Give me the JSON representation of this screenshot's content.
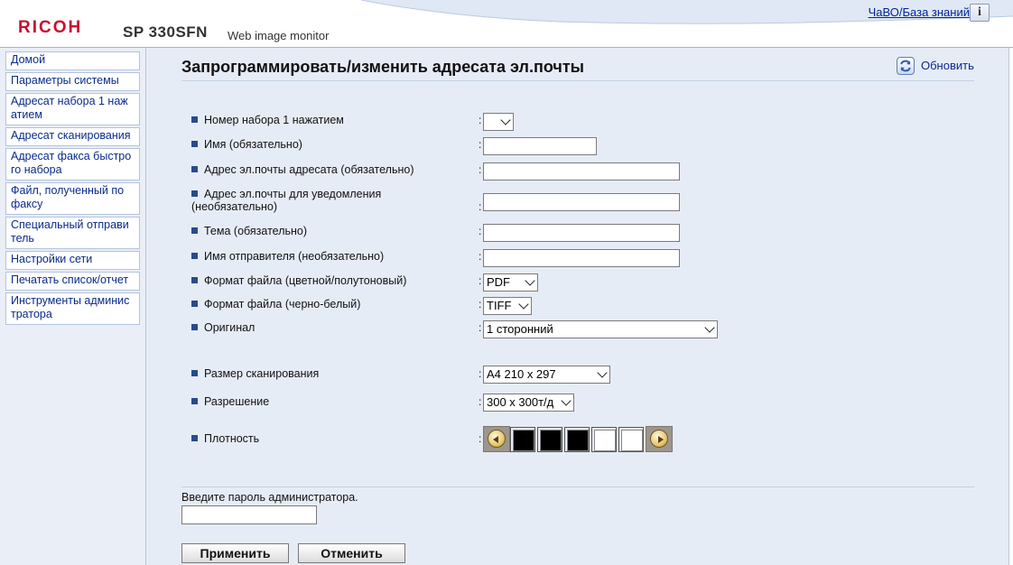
{
  "header": {
    "brand": "RICOH",
    "model": "SP 330SFN",
    "subtitle": "Web image monitor",
    "faq_link": "ЧаВО/База знаний",
    "info_icon_glyph": "i"
  },
  "sidebar": {
    "items": [
      {
        "label": "Домой"
      },
      {
        "label": "Параметры системы"
      },
      {
        "label": "Адресат набора 1 наж атием"
      },
      {
        "label": "Адресат сканирования"
      },
      {
        "label": "Адресат факса быстро го набора"
      },
      {
        "label": "Файл, полученный по факсу"
      },
      {
        "label": "Специальный отправи тель"
      },
      {
        "label": "Настройки сети"
      },
      {
        "label": "Печатать список/отчет"
      },
      {
        "label": "Инструменты админис тратора"
      }
    ]
  },
  "main": {
    "title": "Запрограммировать/изменить адресата эл.почты",
    "refresh_label": "Обновить",
    "colon": ":",
    "fields": {
      "speed_dial": {
        "label": "Номер набора 1 нажатием",
        "value": ""
      },
      "name": {
        "label": "Имя (обязательно)",
        "value": ""
      },
      "email": {
        "label": "Адрес эл.почты адресата (обязательно)",
        "value": ""
      },
      "notify_email": {
        "label": "Адрес эл.почты для уведомления (необязательно)",
        "value": ""
      },
      "subject": {
        "label": "Тема (обязательно)",
        "value": ""
      },
      "sender_name": {
        "label": "Имя отправителя (необязательно)",
        "value": ""
      },
      "file_format_color": {
        "label": "Формат файла (цветной/полутоновый)",
        "value": "PDF"
      },
      "file_format_bw": {
        "label": "Формат файла (черно-белый)",
        "value": "TIFF"
      },
      "original": {
        "label": "Оригинал",
        "value": "1 сторонний"
      },
      "scan_size": {
        "label": "Размер сканирования",
        "value": "A4 210 x 297"
      },
      "resolution": {
        "label": "Разрешение",
        "value": "300 x 300т/д"
      },
      "density": {
        "label": "Плотность",
        "level": 3,
        "max": 5
      }
    },
    "password": {
      "label": "Введите пароль администратора.",
      "value": ""
    },
    "buttons": {
      "apply": "Применить",
      "cancel": "Отменить"
    }
  },
  "colors": {
    "brand_red": "#c8102e",
    "link_blue": "#00249c",
    "sidebar_bg": "#e9eef7",
    "main_bg": "#e6ecf6",
    "bullet": "#2a4a8a"
  }
}
